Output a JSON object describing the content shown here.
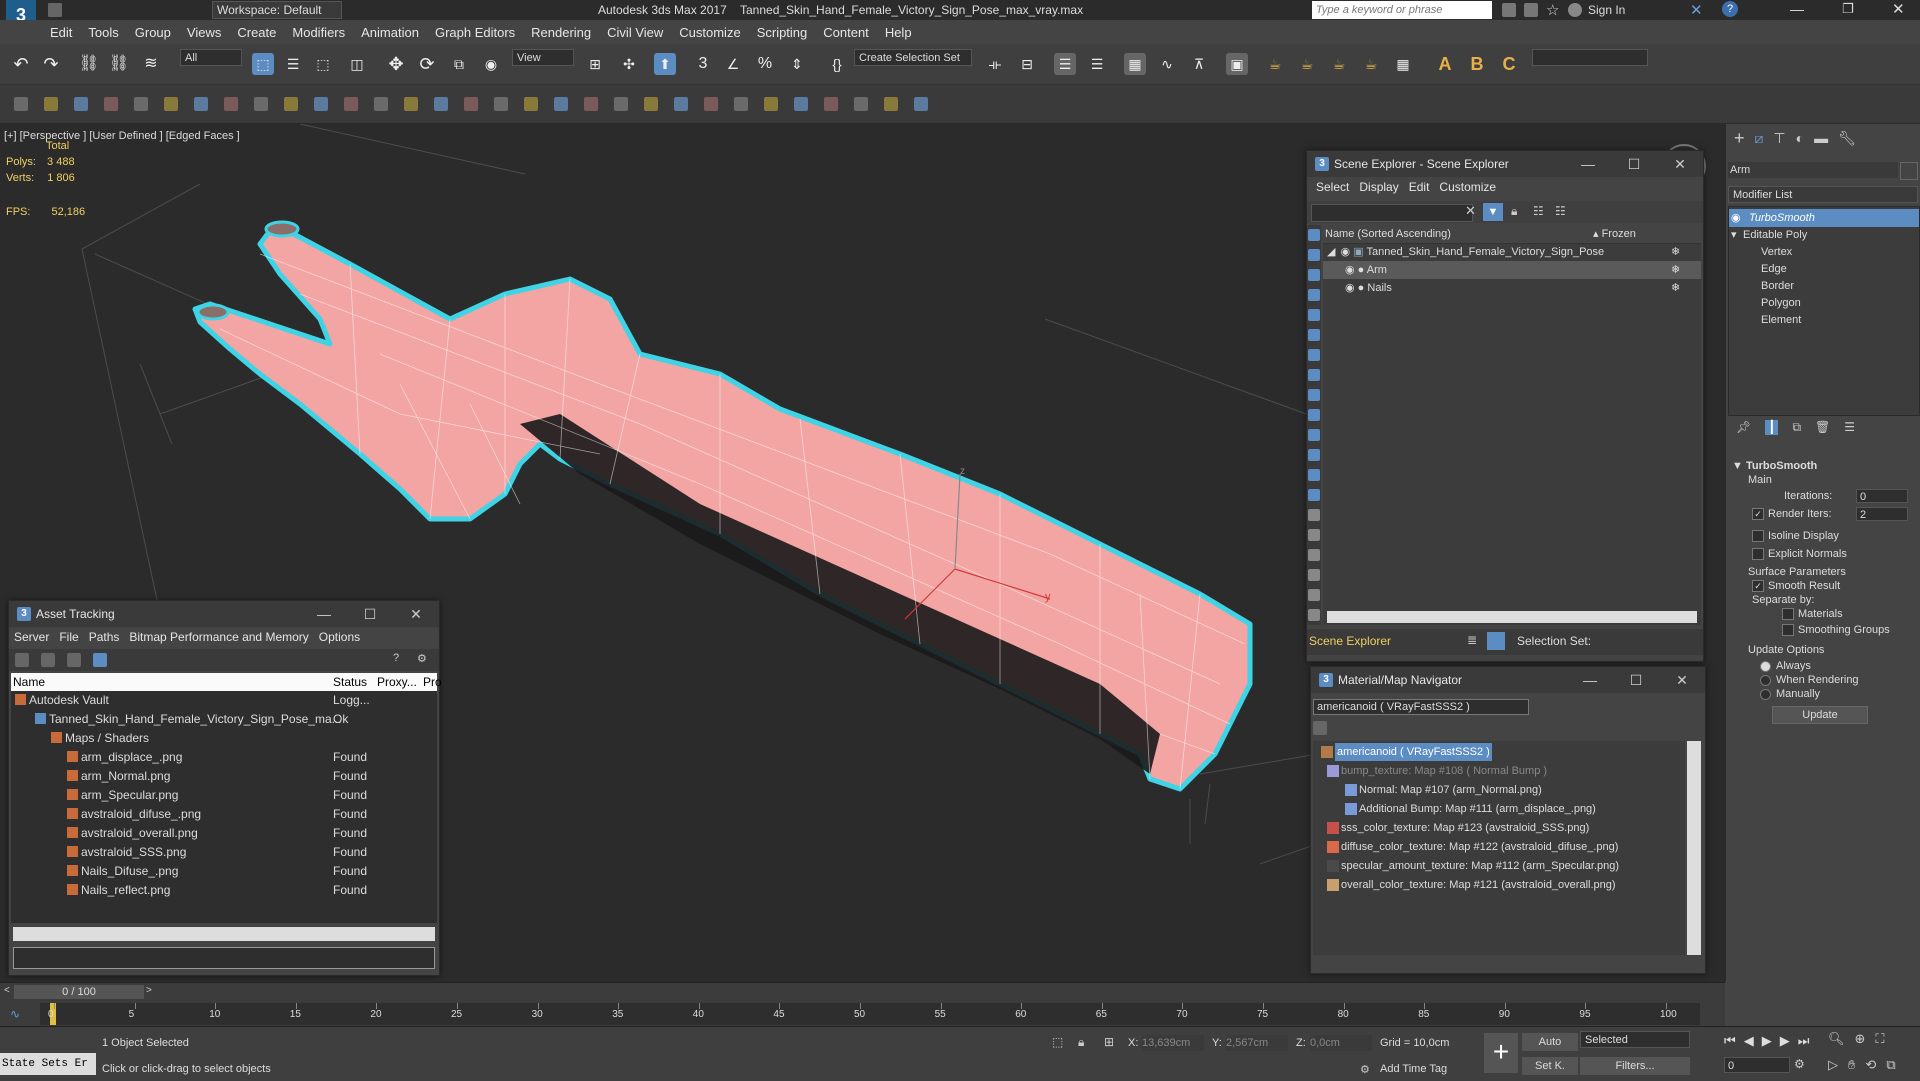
{
  "titlebar": {
    "workspace_label": "Workspace: Default",
    "app_name": "Autodesk 3ds Max 2017",
    "file_name": "Tanned_Skin_Hand_Female_Victory_Sign_Pose_max_vray.max",
    "search_placeholder": "Type a keyword or phrase",
    "sign_in": "Sign In"
  },
  "menu": [
    "Edit",
    "Tools",
    "Group",
    "Views",
    "Create",
    "Modifiers",
    "Animation",
    "Graph Editors",
    "Rendering",
    "Civil View",
    "Customize",
    "Scripting",
    "Content",
    "Help"
  ],
  "toolbar": {
    "filter_value": "All",
    "refcoord_value": "View",
    "selection_set_value": "Create Selection Set"
  },
  "viewport": {
    "label_plus": "[+]",
    "label_view": "[Perspective ]",
    "label_shading": "[User Defined ]",
    "label_edged": "[Edged Faces ]",
    "stats_total": "Total",
    "polys_label": "Polys:",
    "polys_value": "3 488",
    "verts_label": "Verts:",
    "verts_value": "1 806",
    "fps_label": "FPS:",
    "fps_value": "52,186",
    "colors": {
      "skin": "#f2a5a3",
      "selection": "#3fd3e6",
      "background": "#2b2b2b"
    }
  },
  "scene_explorer": {
    "title": "Scene Explorer - Scene Explorer",
    "menu": [
      "Select",
      "Display",
      "Edit",
      "Customize"
    ],
    "col_name": "Name (Sorted Ascending)",
    "col_frozen": "▴ Frozen",
    "items": [
      {
        "label": "Tanned_Skin_Hand_Female_Victory_Sign_Pose"
      },
      {
        "label": "Arm"
      },
      {
        "label": "Nails"
      }
    ],
    "footer_name": "Scene Explorer",
    "footer_selection": "Selection Set:"
  },
  "asset_tracking": {
    "title": "Asset Tracking",
    "menu": [
      "Server",
      "File",
      "Paths",
      "Bitmap Performance and Memory",
      "Options"
    ],
    "columns": [
      "Name",
      "Status",
      "Proxy...",
      "Pro"
    ],
    "rows": [
      {
        "name": "Autodesk Vault",
        "status": "Logg..."
      },
      {
        "name": "Tanned_Skin_Hand_Female_Victory_Sign_Pose_ma...",
        "status": "Ok"
      },
      {
        "name": "Maps / Shaders",
        "status": ""
      },
      {
        "name": "arm_displace_.png",
        "status": "Found"
      },
      {
        "name": "arm_Normal.png",
        "status": "Found"
      },
      {
        "name": "arm_Specular.png",
        "status": "Found"
      },
      {
        "name": "avstraloid_difuse_.png",
        "status": "Found"
      },
      {
        "name": "avstraloid_overall.png",
        "status": "Found"
      },
      {
        "name": "avstraloid_SSS.png",
        "status": "Found"
      },
      {
        "name": "Nails_Difuse_.png",
        "status": "Found"
      },
      {
        "name": "Nails_reflect.png",
        "status": "Found"
      }
    ]
  },
  "material_navigator": {
    "title": "Material/Map Navigator",
    "field_value": "americanoid  ( VRayFastSSS2 )",
    "items": [
      {
        "label": "americanoid  ( VRayFastSSS2 )"
      },
      {
        "label": "bump_texture: Map #108  ( Normal Bump )"
      },
      {
        "label": "Normal: Map #107 (arm_Normal.png)"
      },
      {
        "label": "Additional Bump: Map #111 (arm_displace_.png)"
      },
      {
        "label": "sss_color_texture: Map #123 (avstraloid_SSS.png)"
      },
      {
        "label": "diffuse_color_texture: Map #122 (avstraloid_difuse_.png)"
      },
      {
        "label": "specular_amount_texture: Map #112 (arm_Specular.png)"
      },
      {
        "label": "overall_color_texture: Map #121 (avstraloid_overall.png)"
      }
    ]
  },
  "command_panel": {
    "object_name": "Arm",
    "modifier_list": "Modifier List",
    "stack": [
      {
        "label": "TurboSmooth"
      },
      {
        "label": "Editable Poly"
      },
      {
        "label": "Vertex"
      },
      {
        "label": "Edge"
      },
      {
        "label": "Border"
      },
      {
        "label": "Polygon"
      },
      {
        "label": "Element"
      }
    ],
    "rollout_title": "TurboSmooth",
    "main_label": "Main",
    "iterations_label": "Iterations:",
    "iterations_value": "0",
    "render_iters_label": "Render Iters:",
    "render_iters_value": "2",
    "isoline_label": "Isoline Display",
    "explicit_normals_label": "Explicit Normals",
    "surface_params_label": "Surface Parameters",
    "smooth_result_label": "Smooth Result",
    "separate_by_label": "Separate by:",
    "materials_label": "Materials",
    "smoothing_groups_label": "Smoothing Groups",
    "update_options_label": "Update Options",
    "always_label": "Always",
    "when_rendering_label": "When Rendering",
    "manually_label": "Manually",
    "update_button": "Update"
  },
  "timeline": {
    "frame_counter": "0 / 100",
    "ticks": [
      "0",
      "5",
      "10",
      "15",
      "20",
      "25",
      "30",
      "35",
      "40",
      "45",
      "50",
      "55",
      "60",
      "65",
      "70",
      "75",
      "80",
      "85",
      "90",
      "95",
      "100"
    ]
  },
  "status": {
    "maxscript": "State Sets Er",
    "selected_text": "1 Object Selected",
    "prompt_text": "Click or click-drag to select objects",
    "x_label": "X:",
    "x_value": "13,639cm",
    "y_label": "Y:",
    "y_value": "2,567cm",
    "z_label": "Z:",
    "z_value": "0,0cm",
    "grid_text": "Grid = 10,0cm",
    "add_time_tag": "Add Time Tag",
    "auto_label": "Auto",
    "set_key_label": "Set K.",
    "selected_dd": "Selected",
    "filters_label": "Filters...",
    "frame_field": "0"
  }
}
